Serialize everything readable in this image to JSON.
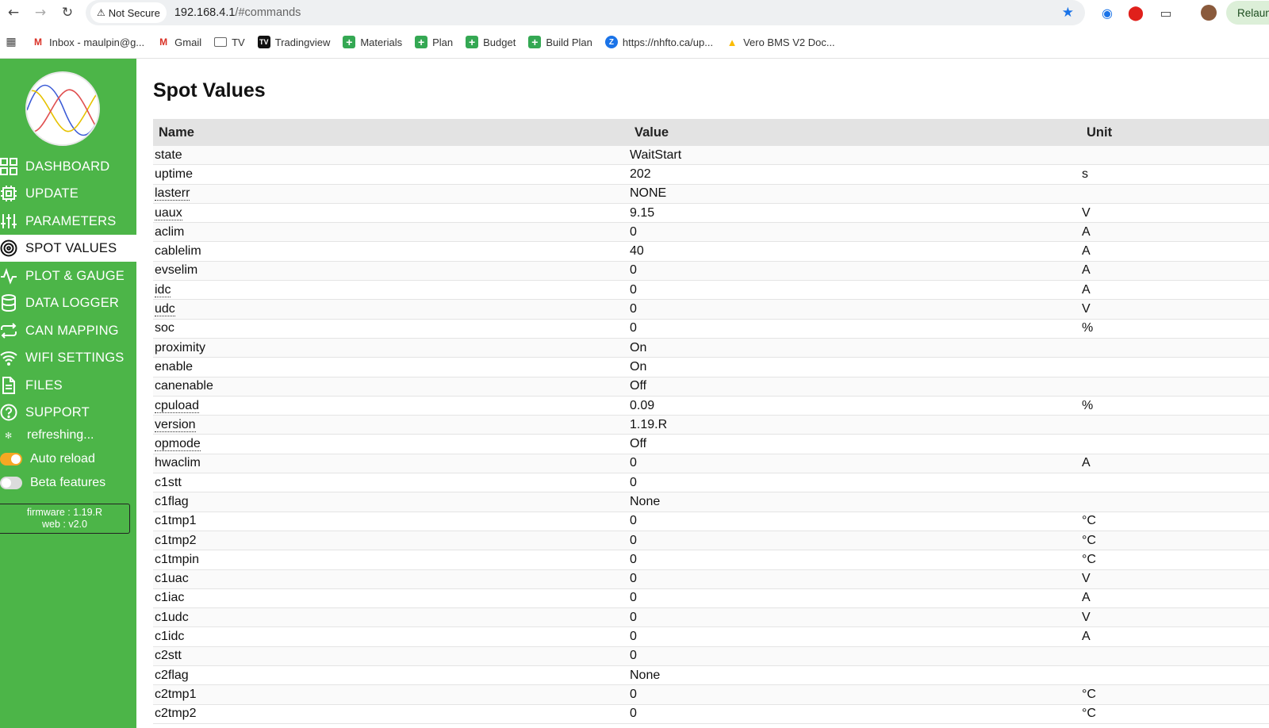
{
  "browser": {
    "security_label": "Not Secure",
    "url_host": "192.168.4.1",
    "url_path": "/#commands",
    "relaunch_label": "Relaun"
  },
  "bookmarks": [
    {
      "label": "Inbox - maulpin@g...",
      "icon": "gmail-icon"
    },
    {
      "label": "Gmail",
      "icon": "gmail-icon"
    },
    {
      "label": "TV",
      "icon": "folder-icon"
    },
    {
      "label": "Tradingview",
      "icon": "tradingview-icon"
    },
    {
      "label": "Materials",
      "icon": "sheets-icon"
    },
    {
      "label": "Plan",
      "icon": "sheets-icon"
    },
    {
      "label": "Budget",
      "icon": "sheets-icon"
    },
    {
      "label": "Build Plan",
      "icon": "sheets-icon"
    },
    {
      "label": "https://nhfto.ca/up...",
      "icon": "zoom-icon"
    },
    {
      "label": "Vero BMS V2 Doc...",
      "icon": "drive-icon"
    }
  ],
  "sidebar": {
    "accent_color": "#4cb548",
    "items": [
      {
        "label": "DASHBOARD",
        "icon": "dashboard-icon"
      },
      {
        "label": "UPDATE",
        "icon": "chip-icon"
      },
      {
        "label": "PARAMETERS",
        "icon": "sliders-icon"
      },
      {
        "label": "SPOT VALUES",
        "icon": "target-icon",
        "active": true
      },
      {
        "label": "PLOT & GAUGE",
        "icon": "pulse-icon"
      },
      {
        "label": "DATA LOGGER",
        "icon": "database-icon"
      },
      {
        "label": "CAN MAPPING",
        "icon": "repeat-icon"
      },
      {
        "label": "WIFI SETTINGS",
        "icon": "wifi-icon"
      },
      {
        "label": "FILES",
        "icon": "file-icon"
      },
      {
        "label": "SUPPORT",
        "icon": "help-icon"
      }
    ],
    "refreshing_label": "refreshing...",
    "auto_reload_label": "Auto reload",
    "auto_reload_on": true,
    "beta_label": "Beta features",
    "beta_on": false,
    "firmware_label": "firmware : 1.19.R",
    "web_label": "web : v2.0"
  },
  "main": {
    "title": "Spot Values",
    "columns": {
      "name": "Name",
      "value": "Value",
      "unit": "Unit"
    },
    "rows": [
      {
        "name": "state",
        "value": "WaitStart",
        "unit": "",
        "dotted": false
      },
      {
        "name": "uptime",
        "value": "202",
        "unit": "s",
        "dotted": false
      },
      {
        "name": "lasterr",
        "value": "NONE",
        "unit": "",
        "dotted": true
      },
      {
        "name": "uaux",
        "value": "9.15",
        "unit": "V",
        "dotted": true
      },
      {
        "name": "aclim",
        "value": "0",
        "unit": "A",
        "dotted": false
      },
      {
        "name": "cablelim",
        "value": "40",
        "unit": "A",
        "dotted": false
      },
      {
        "name": "evselim",
        "value": "0",
        "unit": "A",
        "dotted": false
      },
      {
        "name": "idc",
        "value": "0",
        "unit": "A",
        "dotted": true
      },
      {
        "name": "udc",
        "value": "0",
        "unit": "V",
        "dotted": true
      },
      {
        "name": "soc",
        "value": "0",
        "unit": "%",
        "dotted": false
      },
      {
        "name": "proximity",
        "value": "On",
        "unit": "",
        "dotted": false
      },
      {
        "name": "enable",
        "value": "On",
        "unit": "",
        "dotted": false
      },
      {
        "name": "canenable",
        "value": "Off",
        "unit": "",
        "dotted": false
      },
      {
        "name": "cpuload",
        "value": "0.09",
        "unit": "%",
        "dotted": true
      },
      {
        "name": "version",
        "value": "1.19.R",
        "unit": "",
        "dotted": true
      },
      {
        "name": "opmode",
        "value": "Off",
        "unit": "",
        "dotted": true
      },
      {
        "name": "hwaclim",
        "value": "0",
        "unit": "A",
        "dotted": false
      },
      {
        "name": "c1stt",
        "value": "0",
        "unit": "",
        "dotted": false
      },
      {
        "name": "c1flag",
        "value": "None",
        "unit": "",
        "dotted": false
      },
      {
        "name": "c1tmp1",
        "value": "0",
        "unit": "°C",
        "dotted": false
      },
      {
        "name": "c1tmp2",
        "value": "0",
        "unit": "°C",
        "dotted": false
      },
      {
        "name": "c1tmpin",
        "value": "0",
        "unit": "°C",
        "dotted": false
      },
      {
        "name": "c1uac",
        "value": "0",
        "unit": "V",
        "dotted": false
      },
      {
        "name": "c1iac",
        "value": "0",
        "unit": "A",
        "dotted": false
      },
      {
        "name": "c1udc",
        "value": "0",
        "unit": "V",
        "dotted": false
      },
      {
        "name": "c1idc",
        "value": "0",
        "unit": "A",
        "dotted": false
      },
      {
        "name": "c2stt",
        "value": "0",
        "unit": "",
        "dotted": false
      },
      {
        "name": "c2flag",
        "value": "None",
        "unit": "",
        "dotted": false
      },
      {
        "name": "c2tmp1",
        "value": "0",
        "unit": "°C",
        "dotted": false
      },
      {
        "name": "c2tmp2",
        "value": "0",
        "unit": "°C",
        "dotted": false
      }
    ]
  }
}
